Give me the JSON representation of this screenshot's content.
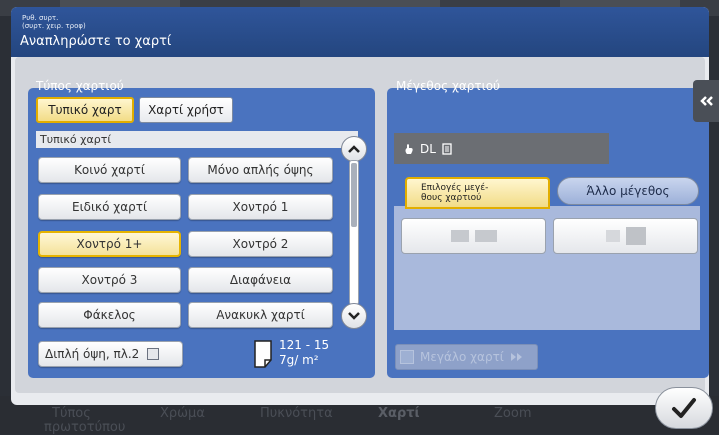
{
  "header": {
    "line1": "Ρυθ. συρτ.",
    "line2": "(συρτ. χειρ. τροφ)",
    "title": "Αναπληρώστε το χαρτί"
  },
  "paper_type": {
    "label": "Τύπος χαρτιού",
    "tabs": [
      {
        "label": "Τυπικό χαρτ",
        "selected": true
      },
      {
        "label": "Χαρτί χρήστ",
        "selected": false
      }
    ],
    "list_header": "Τυπικό χαρτί",
    "buttons": [
      {
        "label": "Κοινό χαρτί",
        "selected": false
      },
      {
        "label": "Μόνο απλής όψης",
        "selected": false
      },
      {
        "label": "Ειδικό χαρτί",
        "selected": false
      },
      {
        "label": "Χοντρό 1",
        "selected": false
      },
      {
        "label": "Χοντρό 1+",
        "selected": true
      },
      {
        "label": "Χοντρό 2",
        "selected": false
      },
      {
        "label": "Χοντρό 3",
        "selected": false
      },
      {
        "label": "Διαφάνεια",
        "selected": false
      },
      {
        "label": "Φάκελος",
        "selected": false
      },
      {
        "label": "Ανακυκλ χαρτί",
        "selected": false
      }
    ],
    "duplex_label": "Διπλή όψη, πλ.2",
    "weight_line1": "121 - 15",
    "weight_line2": "7g/ m²"
  },
  "paper_size": {
    "label": "Μέγεθος χαρτιού",
    "current_size": "DL",
    "tab_options_line1": "Επιλογές μεγέ-",
    "tab_options_line2": "θους χαρτιού",
    "tab_other": "Άλλο μέγεθος",
    "large_paper_label": "Μεγάλο χαρτί"
  },
  "bottom_nav": [
    {
      "label": "Τύπος",
      "line2": "πρωτοτύπου"
    },
    {
      "label": "Χρώμα"
    },
    {
      "label": "Πυκνότητα"
    },
    {
      "label": "Χαρτί"
    },
    {
      "label": "Zoom"
    }
  ],
  "icons": {
    "collapse": "double-chevron-left-icon",
    "ok": "checkmark-icon",
    "scroll_up": "chevron-up-icon",
    "scroll_down": "chevron-down-icon"
  },
  "colors": {
    "header_blue": "#2f559a",
    "group_blue": "#4a73bf",
    "selected_yellow": "#e6b400"
  }
}
